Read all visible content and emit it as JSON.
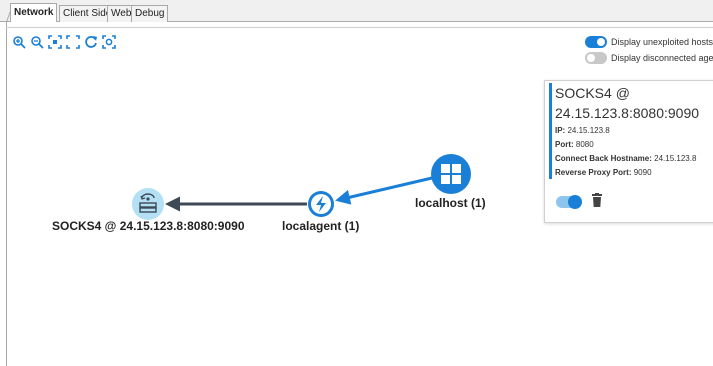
{
  "tabs": [
    {
      "label": "Network",
      "active": true
    },
    {
      "label": "Client Side",
      "active": false
    },
    {
      "label": "Web",
      "active": false
    },
    {
      "label": "Debug",
      "active": false
    }
  ],
  "toolbar": {
    "icons": [
      "zoom-in-icon",
      "zoom-out-icon",
      "fit-icon",
      "fullscreen-icon",
      "refresh-icon",
      "center-icon"
    ]
  },
  "toggles": {
    "unexploited": {
      "label": "Display unexploited hosts",
      "on": true
    },
    "disconnected": {
      "label": "Display disconnected agents",
      "on": false
    }
  },
  "nodes": {
    "localhost": {
      "label": "localhost (1)",
      "icon": "windows-icon"
    },
    "localagent": {
      "label": "localagent (1)",
      "icon": "lightning-icon"
    },
    "socks": {
      "label": "SOCKS4 @ 24.15.123.8:8080:9090",
      "icon": "proxy-server-icon"
    }
  },
  "card": {
    "title_line1": "SOCKS4 @",
    "title_line2": "24.15.123.8:8080:9090",
    "fields": [
      {
        "key": "IP:",
        "value": "24.15.123.8"
      },
      {
        "key": "Port:",
        "value": "8080"
      },
      {
        "key": "Connect Back Hostname:",
        "value": "24.15.123.8"
      },
      {
        "key": "Reverse Proxy Port:",
        "value": "9090"
      }
    ],
    "enabled": true
  },
  "colors": {
    "accent": "#1a7fd6",
    "edge_dark": "#3d4a55",
    "socks_node_bg": "#b3e0f5"
  }
}
